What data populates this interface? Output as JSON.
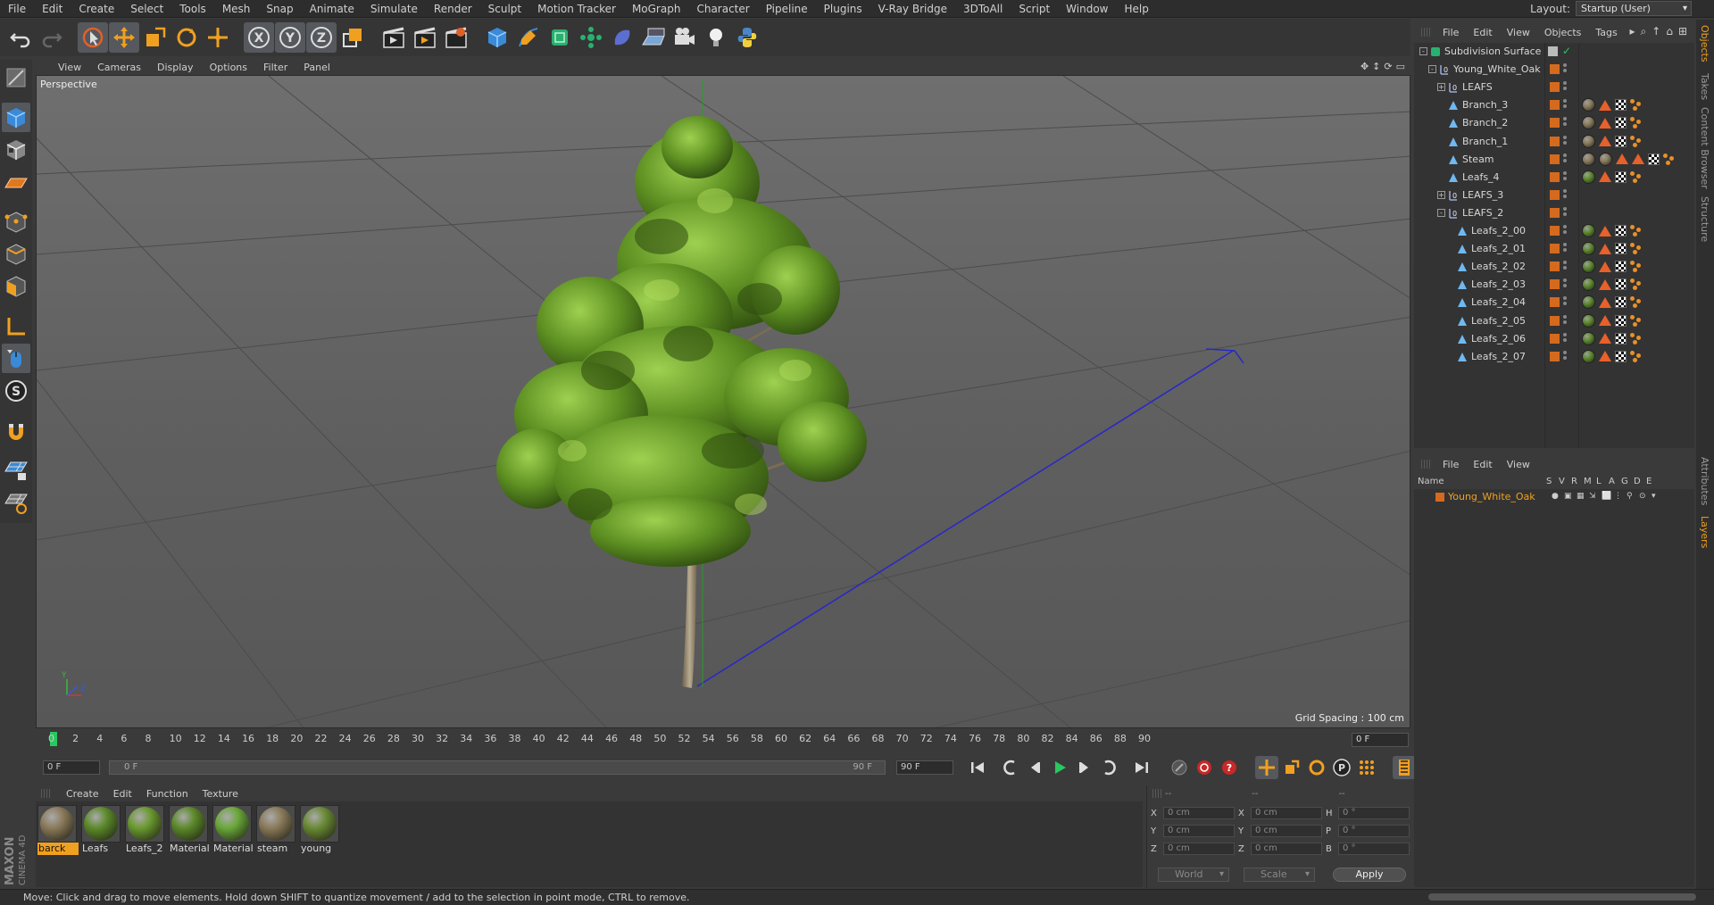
{
  "menubar": {
    "items": [
      "File",
      "Edit",
      "Create",
      "Select",
      "Tools",
      "Mesh",
      "Snap",
      "Animate",
      "Simulate",
      "Render",
      "Sculpt",
      "Motion Tracker",
      "MoGraph",
      "Character",
      "Pipeline",
      "Plugins",
      "V-Ray Bridge",
      "3DToAll",
      "Script",
      "Window",
      "Help"
    ],
    "layout_label": "Layout:",
    "layout_value": "Startup (User)"
  },
  "viewport": {
    "menu": [
      "View",
      "Cameras",
      "Display",
      "Options",
      "Filter",
      "Panel"
    ],
    "label": "Perspective",
    "grid_spacing": "Grid Spacing : 100 cm"
  },
  "timeline": {
    "ticks": [
      "0",
      "2",
      "4",
      "6",
      "8",
      "10",
      "12",
      "14",
      "16",
      "18",
      "20",
      "22",
      "24",
      "26",
      "28",
      "30",
      "32",
      "34",
      "36",
      "38",
      "40",
      "42",
      "44",
      "46",
      "48",
      "50",
      "52",
      "54",
      "56",
      "58",
      "60",
      "62",
      "64",
      "66",
      "68",
      "70",
      "72",
      "74",
      "76",
      "78",
      "80",
      "82",
      "84",
      "86",
      "88",
      "90"
    ],
    "current_frame": "0 F",
    "start_field": "0 F",
    "range_start": "0 F",
    "range_end": "90 F",
    "end_field": "90 F"
  },
  "material_manager": {
    "menu": [
      "Create",
      "Edit",
      "Function",
      "Texture"
    ],
    "materials": [
      {
        "name": "barck",
        "color": "#8a7a5a",
        "selected": true
      },
      {
        "name": "Leafs",
        "color": "#5c8a2a",
        "selected": false
      },
      {
        "name": "Leafs_2",
        "color": "#6a9a30",
        "selected": false
      },
      {
        "name": "Material",
        "color": "#5c8a2a",
        "selected": false
      },
      {
        "name": "Material",
        "color": "#6aa83a",
        "selected": false
      },
      {
        "name": "steam",
        "color": "#8a7a5a",
        "selected": false
      },
      {
        "name": "young",
        "color": "#6a8a35",
        "selected": false
      }
    ]
  },
  "coordinates": {
    "headers": [
      "--",
      "--",
      "--"
    ],
    "rows": [
      {
        "l1": "X",
        "v1": "0 cm",
        "l2": "X",
        "v2": "0 cm",
        "l3": "H",
        "v3": "0 °"
      },
      {
        "l1": "Y",
        "v1": "0 cm",
        "l2": "Y",
        "v2": "0 cm",
        "l3": "P",
        "v3": "0 °"
      },
      {
        "l1": "Z",
        "v1": "0 cm",
        "l2": "Z",
        "v2": "0 cm",
        "l3": "B",
        "v3": "0 °"
      }
    ],
    "space": "World",
    "mode": "Scale",
    "apply": "Apply"
  },
  "object_manager": {
    "menu": [
      "File",
      "Edit",
      "View",
      "Objects",
      "Tags"
    ],
    "objects": [
      {
        "name": "Subdivision Surface",
        "indent": 0,
        "type": "subdiv",
        "expand": "-",
        "tags": []
      },
      {
        "name": "Young_White_Oak",
        "indent": 1,
        "type": "null",
        "expand": "-",
        "tags": []
      },
      {
        "name": "LEAFS",
        "indent": 2,
        "type": "null",
        "expand": "+",
        "tags": []
      },
      {
        "name": "Branch_3",
        "indent": 2,
        "type": "poly",
        "expand": "",
        "tags": [
          "bark",
          "tri",
          "chk",
          "uv"
        ]
      },
      {
        "name": "Branch_2",
        "indent": 2,
        "type": "poly",
        "expand": "",
        "tags": [
          "bark",
          "tri",
          "chk",
          "uv"
        ]
      },
      {
        "name": "Branch_1",
        "indent": 2,
        "type": "poly",
        "expand": "",
        "tags": [
          "bark",
          "tri",
          "chk",
          "uv"
        ]
      },
      {
        "name": "Steam",
        "indent": 2,
        "type": "poly",
        "expand": "",
        "tags": [
          "bark",
          "bark",
          "tri",
          "tri",
          "chk",
          "uv"
        ]
      },
      {
        "name": "Leafs_4",
        "indent": 2,
        "type": "poly",
        "expand": "",
        "tags": [
          "leaf",
          "tri",
          "chk",
          "uv"
        ]
      },
      {
        "name": "LEAFS_3",
        "indent": 2,
        "type": "null",
        "expand": "+",
        "tags": []
      },
      {
        "name": "LEAFS_2",
        "indent": 2,
        "type": "null",
        "expand": "-",
        "tags": []
      },
      {
        "name": "Leafs_2_00",
        "indent": 3,
        "type": "poly",
        "expand": "",
        "tags": [
          "leaf",
          "tri",
          "chk",
          "uv"
        ]
      },
      {
        "name": "Leafs_2_01",
        "indent": 3,
        "type": "poly",
        "expand": "",
        "tags": [
          "leaf",
          "tri",
          "chk",
          "uv"
        ]
      },
      {
        "name": "Leafs_2_02",
        "indent": 3,
        "type": "poly",
        "expand": "",
        "tags": [
          "leaf",
          "tri",
          "chk",
          "uv"
        ]
      },
      {
        "name": "Leafs_2_03",
        "indent": 3,
        "type": "poly",
        "expand": "",
        "tags": [
          "leaf",
          "tri",
          "chk",
          "uv"
        ]
      },
      {
        "name": "Leafs_2_04",
        "indent": 3,
        "type": "poly",
        "expand": "",
        "tags": [
          "leaf",
          "tri",
          "chk",
          "uv"
        ]
      },
      {
        "name": "Leafs_2_05",
        "indent": 3,
        "type": "poly",
        "expand": "",
        "tags": [
          "leaf",
          "tri",
          "chk",
          "uv"
        ]
      },
      {
        "name": "Leafs_2_06",
        "indent": 3,
        "type": "poly",
        "expand": "",
        "tags": [
          "leaf",
          "tri",
          "chk",
          "uv"
        ]
      },
      {
        "name": "Leafs_2_07",
        "indent": 3,
        "type": "poly",
        "expand": "",
        "tags": [
          "leaf",
          "tri",
          "chk",
          "uv"
        ]
      }
    ]
  },
  "layer_manager": {
    "menu": [
      "File",
      "Edit",
      "View"
    ],
    "columns": [
      "Name",
      "S",
      "V",
      "R",
      "M",
      "L",
      "A",
      "G",
      "D",
      "E"
    ],
    "layers": [
      {
        "name": "Young_White_Oak"
      }
    ]
  },
  "side_tabs": [
    "Objects",
    "Takes",
    "Content Browser",
    "Structure",
    "Attributes",
    "Layers"
  ],
  "status": "Move: Click and drag to move elements. Hold down SHIFT to quantize movement / add to the selection in point mode, CTRL to remove.",
  "brand": {
    "line1": "MAXON",
    "line2": "CINEMA 4D"
  },
  "colors": {
    "accent": "#f0a020",
    "layer": "#d46a1e",
    "play": "#29c860"
  }
}
